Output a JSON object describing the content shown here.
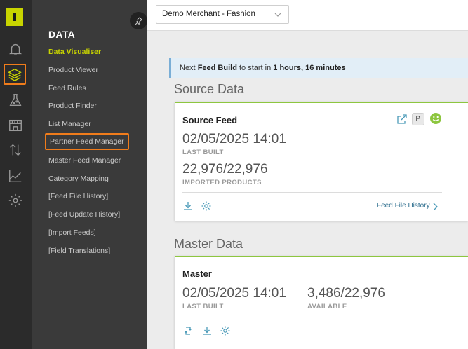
{
  "rail": {
    "icons": [
      "bell-icon",
      "layers-icon",
      "flask-icon",
      "store-icon",
      "transfer-icon",
      "chart-icon",
      "gear-icon"
    ]
  },
  "submenu": {
    "title": "DATA",
    "items": [
      {
        "label": "Data Visualiser"
      },
      {
        "label": "Product Viewer"
      },
      {
        "label": "Feed Rules"
      },
      {
        "label": "Product Finder"
      },
      {
        "label": "List Manager"
      },
      {
        "label": "Partner Feed Manager"
      },
      {
        "label": "Master Feed Manager"
      },
      {
        "label": "Category Mapping"
      },
      {
        "label": "[Feed File History]"
      },
      {
        "label": "[Feed Update History]"
      },
      {
        "label": "[Import Feeds]"
      },
      {
        "label": "[Field Translations]"
      }
    ]
  },
  "topbar": {
    "merchant_select": "Demo Merchant - Fashion"
  },
  "notice": {
    "prefix": "Next ",
    "feed_build": "Feed Build",
    "middle": " to start in ",
    "time": "1 hours, 16 minutes"
  },
  "source": {
    "section_title": "Source Data",
    "card_title": "Source Feed",
    "badge": "P",
    "last_built_value": "02/05/2025 14:01",
    "last_built_label": "LAST BUILT",
    "imported_value": "22,976/22,976",
    "imported_label": "IMPORTED PRODUCTS",
    "history_link": "Feed File History"
  },
  "master": {
    "section_title": "Master Data",
    "card_title": "Master",
    "last_built_value": "02/05/2025 14:01",
    "last_built_label": "LAST BUILT",
    "available_value": "3,486/22,976",
    "available_label": "AVAILABLE"
  },
  "colors": {
    "accent": "#c8d400",
    "highlight": "#f07c1b",
    "card_border": "#8dc63f",
    "status_green": "#8dc63f"
  }
}
